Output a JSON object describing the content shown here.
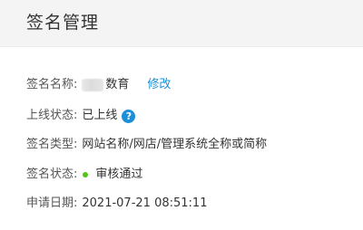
{
  "header": {
    "title": "签名管理"
  },
  "details": {
    "signature_name": {
      "label": "签名名称:",
      "value_suffix": "数育",
      "edit_link": "修改"
    },
    "online_status": {
      "label": "上线状态:",
      "value": "已上线",
      "help_icon": "?"
    },
    "signature_type": {
      "label": "签名类型:",
      "value": "网站名称/网店/管理系统全称或简称"
    },
    "signature_status": {
      "label": "签名状态:",
      "value": "审核通过",
      "status_color": "#52c41a"
    },
    "apply_date": {
      "label": "申请日期:",
      "value": "2021-07-21 08:51:11"
    }
  },
  "colors": {
    "link": "#1a8fd8",
    "header_bg": "#f4f4f4"
  }
}
